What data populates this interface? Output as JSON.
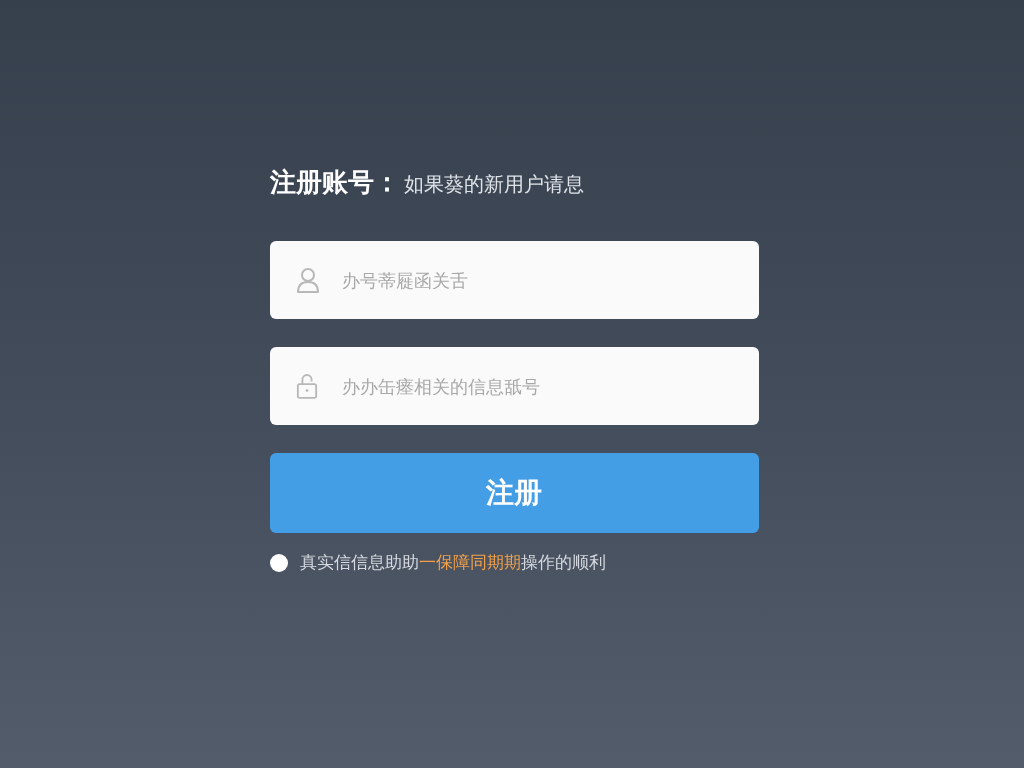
{
  "heading": {
    "title": "注册账号：",
    "subtitle": "如果葵的新用户请息"
  },
  "fields": [
    {
      "kind": "user",
      "placeholder": "办号蒂屣函关舌"
    },
    {
      "kind": "lock",
      "placeholder": "办办缶瘗相关的信息舐号"
    }
  ],
  "submit": {
    "label": "注册"
  },
  "agreement": {
    "checked": false,
    "before": "真实信信息助助",
    "link": "一保障同期期",
    "after": "操作的顺利"
  }
}
